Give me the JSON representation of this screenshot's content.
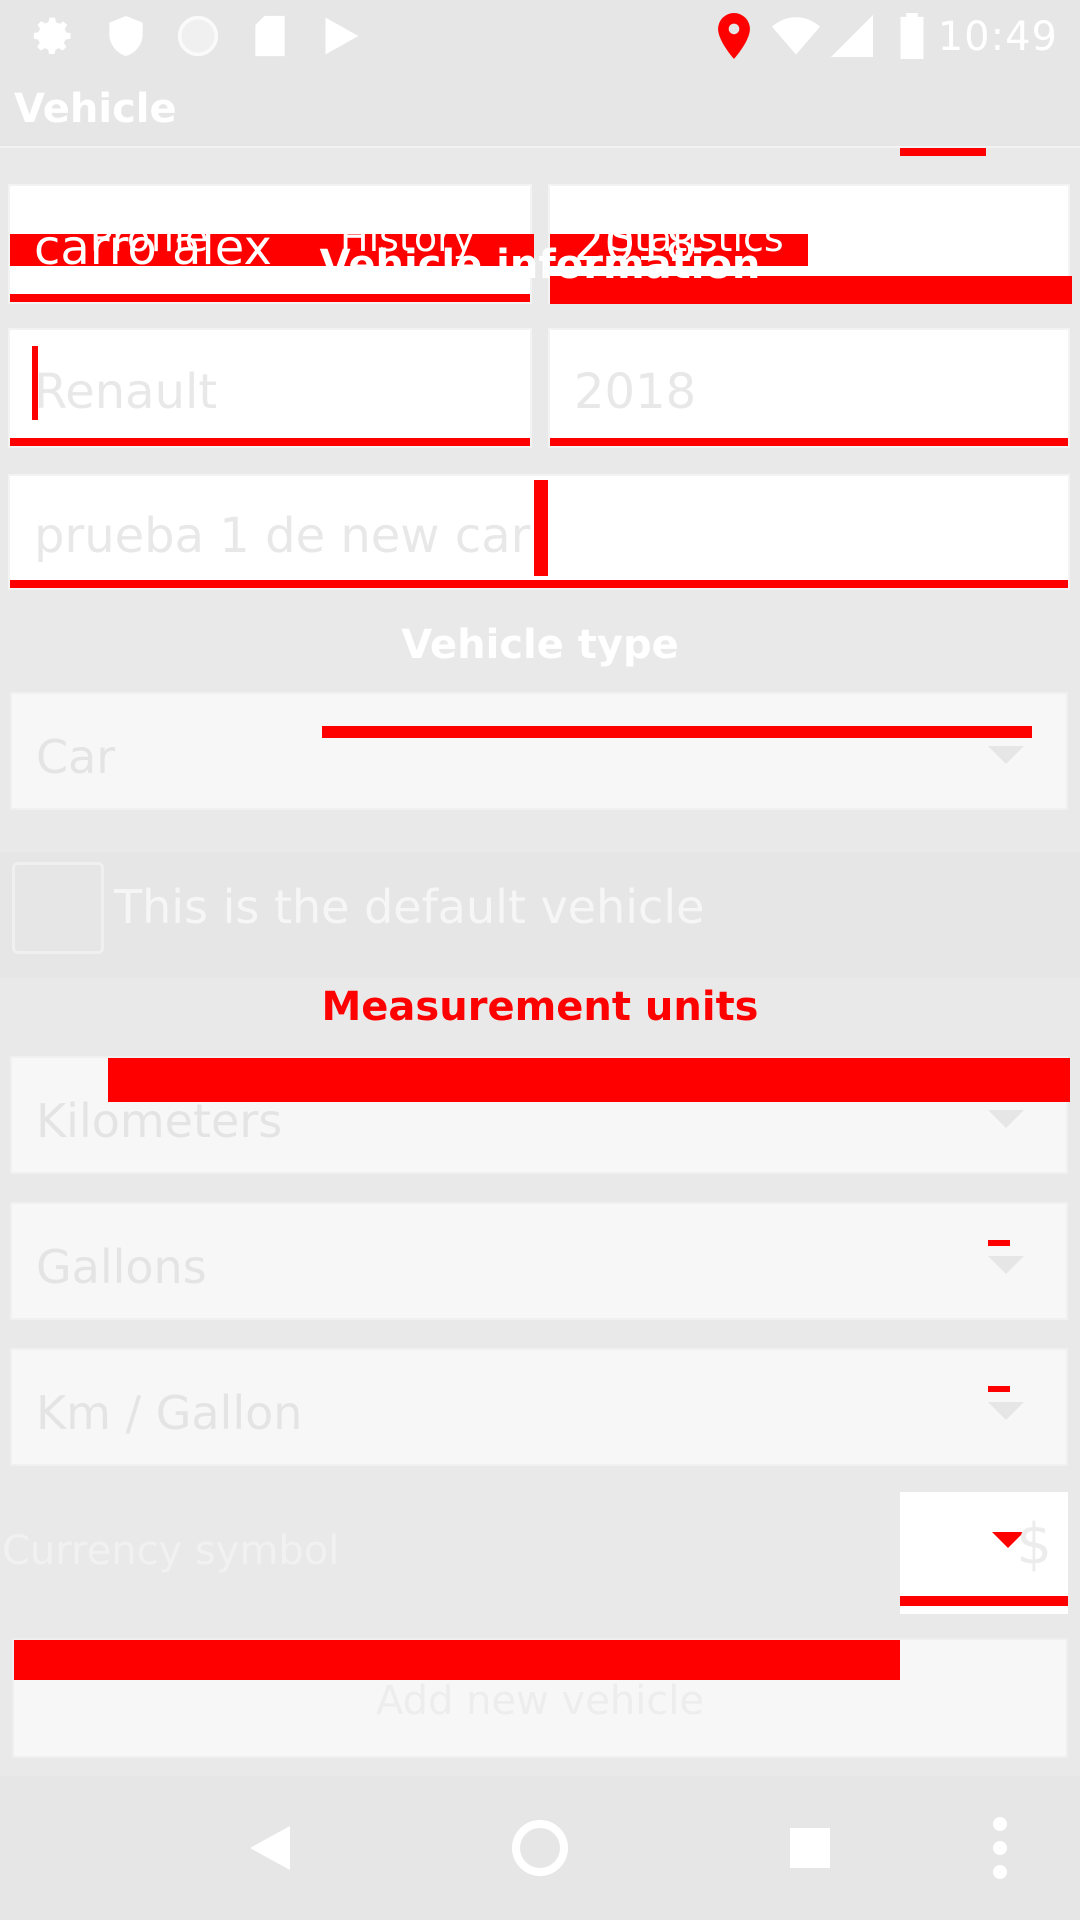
{
  "status_bar": {
    "time": "10:49",
    "icons": [
      "settings-icon",
      "shield-icon",
      "circle-icon",
      "sd-card-icon",
      "play-store-icon",
      "location-pin-icon",
      "wifi-icon",
      "signal-icon",
      "battery-icon"
    ]
  },
  "app_bar": {
    "title": "Vehicle"
  },
  "tabs": [
    "Profile",
    "History",
    "Statistics"
  ],
  "vehicle_info": {
    "title": "Vehicle information",
    "name": "carro alex",
    "year_top": "2018",
    "make": "Renault",
    "model_year": "2018",
    "description": "prueba 1 de new car"
  },
  "vehicle_type": {
    "title": "Vehicle type",
    "selected": "Car"
  },
  "default_vehicle": {
    "label": "This is the default vehicle",
    "checked": false
  },
  "measurement_units": {
    "title": "Measurement units",
    "distance": "Kilometers",
    "volume": "Gallons",
    "efficiency": "Km / Gallon"
  },
  "currency": {
    "label": "Currency symbol",
    "symbol": "$"
  },
  "add_button": {
    "label": "Add new vehicle"
  },
  "colors": {
    "accent": "#ff0000",
    "background": "#e9e9e9",
    "field": "#ffffff"
  }
}
